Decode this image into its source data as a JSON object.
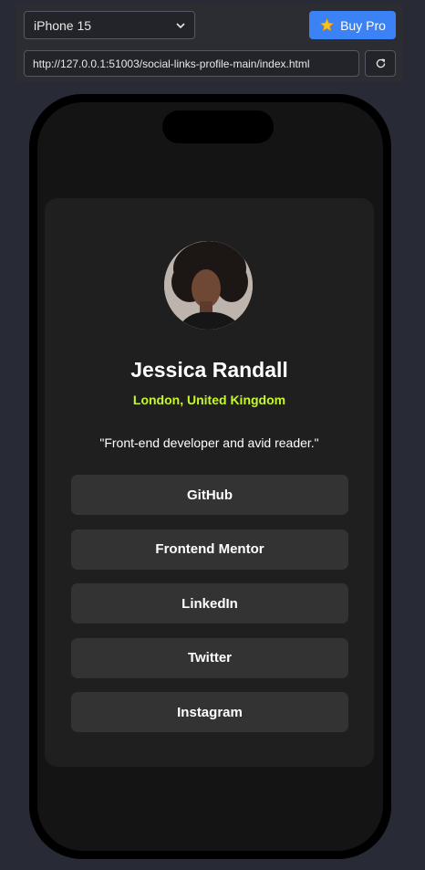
{
  "toolbar": {
    "device": "iPhone 15",
    "buy_label": "Buy Pro",
    "url": "http://127.0.0.1:51003/social-links-profile-main/index.html"
  },
  "profile": {
    "name": "Jessica Randall",
    "location": "London, United Kingdom",
    "bio": "\"Front-end developer and avid reader.\"",
    "links": [
      "GitHub",
      "Frontend Mentor",
      "LinkedIn",
      "Twitter",
      "Instagram"
    ]
  },
  "colors": {
    "accent": "#c4f82a",
    "button_bg": "#333333",
    "card_bg": "#1f1f1f",
    "buy_button": "#3b82f6"
  },
  "icons": {
    "buy": "star-icon",
    "reload": "reload-icon",
    "select": "chevron-down-icon"
  }
}
